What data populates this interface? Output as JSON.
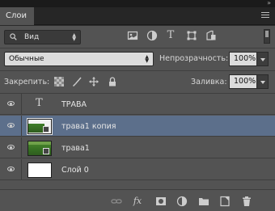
{
  "window": {
    "collapse_glyph": "»"
  },
  "tab": {
    "title": "Слои"
  },
  "filter": {
    "label": "Вид",
    "icons": [
      "image-filter-icon",
      "adjustment-filter-icon",
      "type-filter-icon",
      "shape-filter-icon",
      "smart-object-filter-icon"
    ]
  },
  "blend": {
    "mode": "Обычные"
  },
  "opacity": {
    "label": "Непрозрачность:",
    "value": "100%"
  },
  "lock": {
    "label": "Закрепить:"
  },
  "fill": {
    "label": "Заливка:",
    "value": "100%"
  },
  "layers": [
    {
      "name": "ТРАВА",
      "kind": "text",
      "visible": true,
      "selected": false
    },
    {
      "name": "трава1 копия",
      "kind": "smart",
      "visible": true,
      "selected": true
    },
    {
      "name": "трава1",
      "kind": "smart",
      "visible": true,
      "selected": false
    },
    {
      "name": "Слой 0",
      "kind": "pixel",
      "visible": true,
      "selected": false
    }
  ],
  "icons": {
    "type_glyph": "T",
    "fx": "fx",
    "filter_type": "T"
  }
}
